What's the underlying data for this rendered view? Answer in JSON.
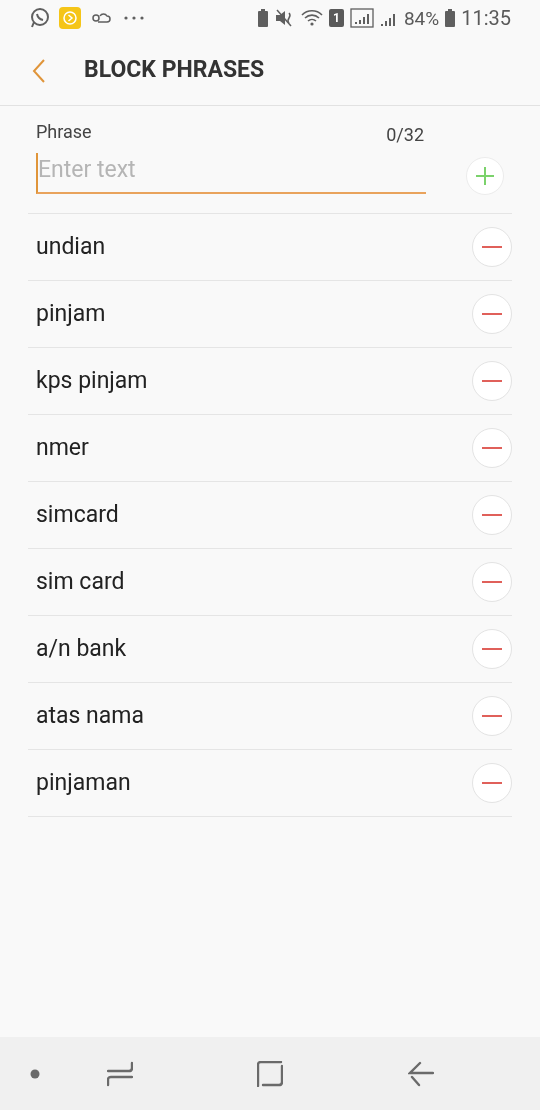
{
  "status_bar": {
    "sim_slot": "1",
    "battery": "84%",
    "time": "11:35"
  },
  "header": {
    "title": "BLOCK PHRASES"
  },
  "phrase_input": {
    "label": "Phrase",
    "counter": "0/32",
    "placeholder": "Enter text"
  },
  "phrases": [
    {
      "text": "undian"
    },
    {
      "text": "pinjam"
    },
    {
      "text": "kps pinjam"
    },
    {
      "text": "nmer"
    },
    {
      "text": "simcard"
    },
    {
      "text": "sim card"
    },
    {
      "text": "a/n bank"
    },
    {
      "text": "atas nama"
    },
    {
      "text": "pinjaman"
    }
  ]
}
